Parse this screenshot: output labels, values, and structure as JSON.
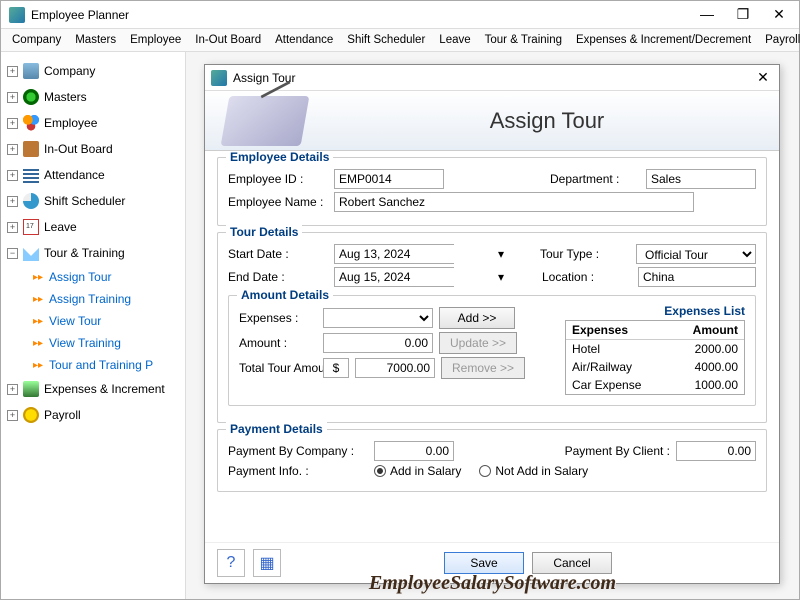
{
  "app": {
    "title": "Employee Planner"
  },
  "winControls": {
    "min": "—",
    "max": "❐",
    "close": "✕"
  },
  "menubar": [
    "Company",
    "Masters",
    "Employee",
    "In-Out Board",
    "Attendance",
    "Shift Scheduler",
    "Leave",
    "Tour & Training",
    "Expenses & Increment/Decrement",
    "Payroll"
  ],
  "sidebar": [
    {
      "label": "Company",
      "icon": "company",
      "expanded": false
    },
    {
      "label": "Masters",
      "icon": "masters",
      "expanded": false
    },
    {
      "label": "Employee",
      "icon": "employee",
      "expanded": false
    },
    {
      "label": "In-Out Board",
      "icon": "inout",
      "expanded": false
    },
    {
      "label": "Attendance",
      "icon": "attendance",
      "expanded": false
    },
    {
      "label": "Shift Scheduler",
      "icon": "shift",
      "expanded": false
    },
    {
      "label": "Leave",
      "icon": "leave",
      "expanded": false
    },
    {
      "label": "Tour & Training",
      "icon": "tour",
      "expanded": true,
      "children": [
        "Assign Tour",
        "Assign Training",
        "View Tour",
        "View Training",
        "Tour and Training P"
      ]
    },
    {
      "label": "Expenses & Increment",
      "icon": "expense",
      "expanded": false
    },
    {
      "label": "Payroll",
      "icon": "payroll",
      "expanded": false
    }
  ],
  "dialog": {
    "title": "Assign Tour",
    "heading": "Assign Tour",
    "groups": {
      "employee": {
        "title": "Employee Details",
        "id_label": "Employee ID :",
        "id_value": "EMP0014",
        "dept_label": "Department :",
        "dept_value": "Sales",
        "name_label": "Employee Name :",
        "name_value": "Robert Sanchez"
      },
      "tour": {
        "title": "Tour Details",
        "start_label": "Start Date :",
        "start_value": "Aug 13, 2024",
        "end_label": "End Date :",
        "end_value": "Aug 15, 2024",
        "type_label": "Tour Type :",
        "type_value": "Official Tour",
        "loc_label": "Location :",
        "loc_value": "China"
      },
      "amount": {
        "title": "Amount Details",
        "expenses_label": "Expenses :",
        "amount_label": "Amount :",
        "amount_value": "0.00",
        "total_label": "Total Tour Amount :",
        "total_currency": "$",
        "total_value": "7000.00",
        "add_btn": "Add >>",
        "update_btn": "Update >>",
        "remove_btn": "Remove >>",
        "list_title": "Expenses List",
        "list_headers": {
          "c1": "Expenses",
          "c2": "Amount"
        },
        "list": [
          {
            "name": "Hotel",
            "amount": "2000.00"
          },
          {
            "name": "Air/Railway",
            "amount": "4000.00"
          },
          {
            "name": "Car Expense",
            "amount": "1000.00"
          }
        ]
      },
      "payment": {
        "title": "Payment Details",
        "company_label": "Payment By Company :",
        "company_value": "0.00",
        "client_label": "Payment By Client :",
        "client_value": "0.00",
        "info_label": "Payment Info. :",
        "opt1": "Add in Salary",
        "opt2": "Not Add in Salary"
      }
    },
    "footer": {
      "save": "Save",
      "cancel": "Cancel"
    }
  },
  "watermark": "EmployeeSalarySoftware.com"
}
